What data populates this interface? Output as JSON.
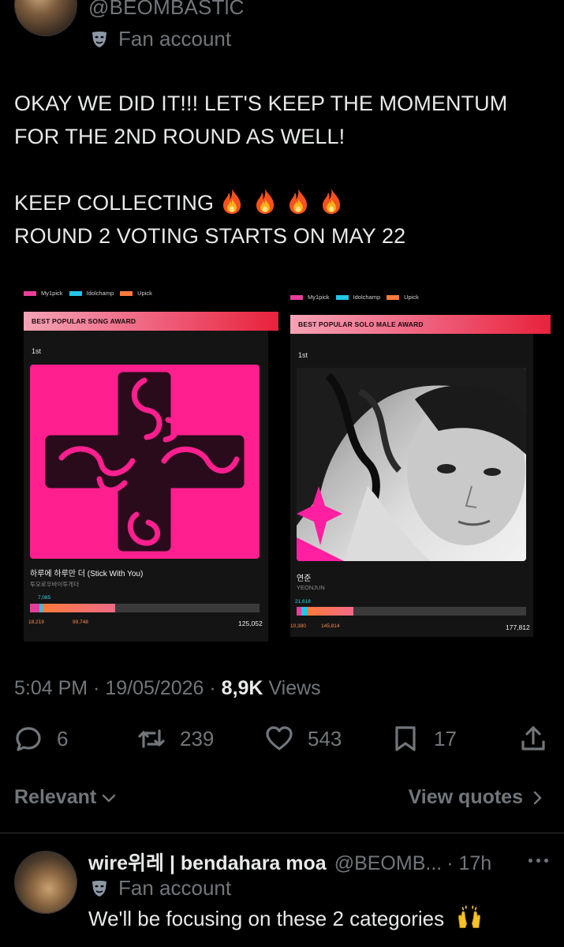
{
  "author": {
    "handle": "@BEOMBASTlC",
    "label": "Fan account",
    "mask_icon": "performing-arts-icon"
  },
  "tweet": {
    "lines": [
      "OKAY WE DID IT!!! LET'S KEEP THE MOMENTUM",
      "FOR THE 2ND ROUND AS WELL!",
      "KEEP COLLECTING",
      "ROUND 2 VOTING STARTS ON MAY 22"
    ],
    "fire_count": 4
  },
  "legend": {
    "items": [
      "My1pick",
      "Idolchamp",
      "Upick"
    ],
    "colors": [
      "#e83e9a",
      "#24c6e8",
      "#ff7a3c"
    ]
  },
  "cards": [
    {
      "award": "BEST POPULAR SONG AWARD",
      "rank": "1st",
      "title": "하루에 하루만 더 (Stick With You)",
      "subtitle": "투모로우바이투게더",
      "top_value": "7,085",
      "left_value": "18,219",
      "mid_value": "99,748",
      "total": "125,052",
      "fill_fraction": 0.36
    },
    {
      "award": "BEST POPULAR SOLO MALE AWARD",
      "rank": "1st",
      "title": "연준",
      "subtitle": "YEONJUN",
      "top_value": "21,618",
      "left_value": "10,380",
      "mid_value": "145,814",
      "total": "177,812",
      "fill_fraction": 0.27
    }
  ],
  "meta": {
    "time": "5:04 PM",
    "date": "19/05/2026",
    "views_count": "8,9K",
    "views_label": "Views"
  },
  "actions": {
    "replies": "6",
    "reposts": "239",
    "likes": "543",
    "bookmarks": "17"
  },
  "sort": {
    "label": "Relevant",
    "view_quotes": "View quotes"
  },
  "reply": {
    "name": "wire위레 | bendahara moa",
    "handle": "@BEOMB...",
    "time": "· 17h",
    "label": "Fan account",
    "text": "We'll be focusing on these 2 categories"
  },
  "colors": {
    "bg": "#000000",
    "text": "#e7e9ea",
    "muted": "#71767b",
    "accent_pink": "#ff1f8e"
  }
}
